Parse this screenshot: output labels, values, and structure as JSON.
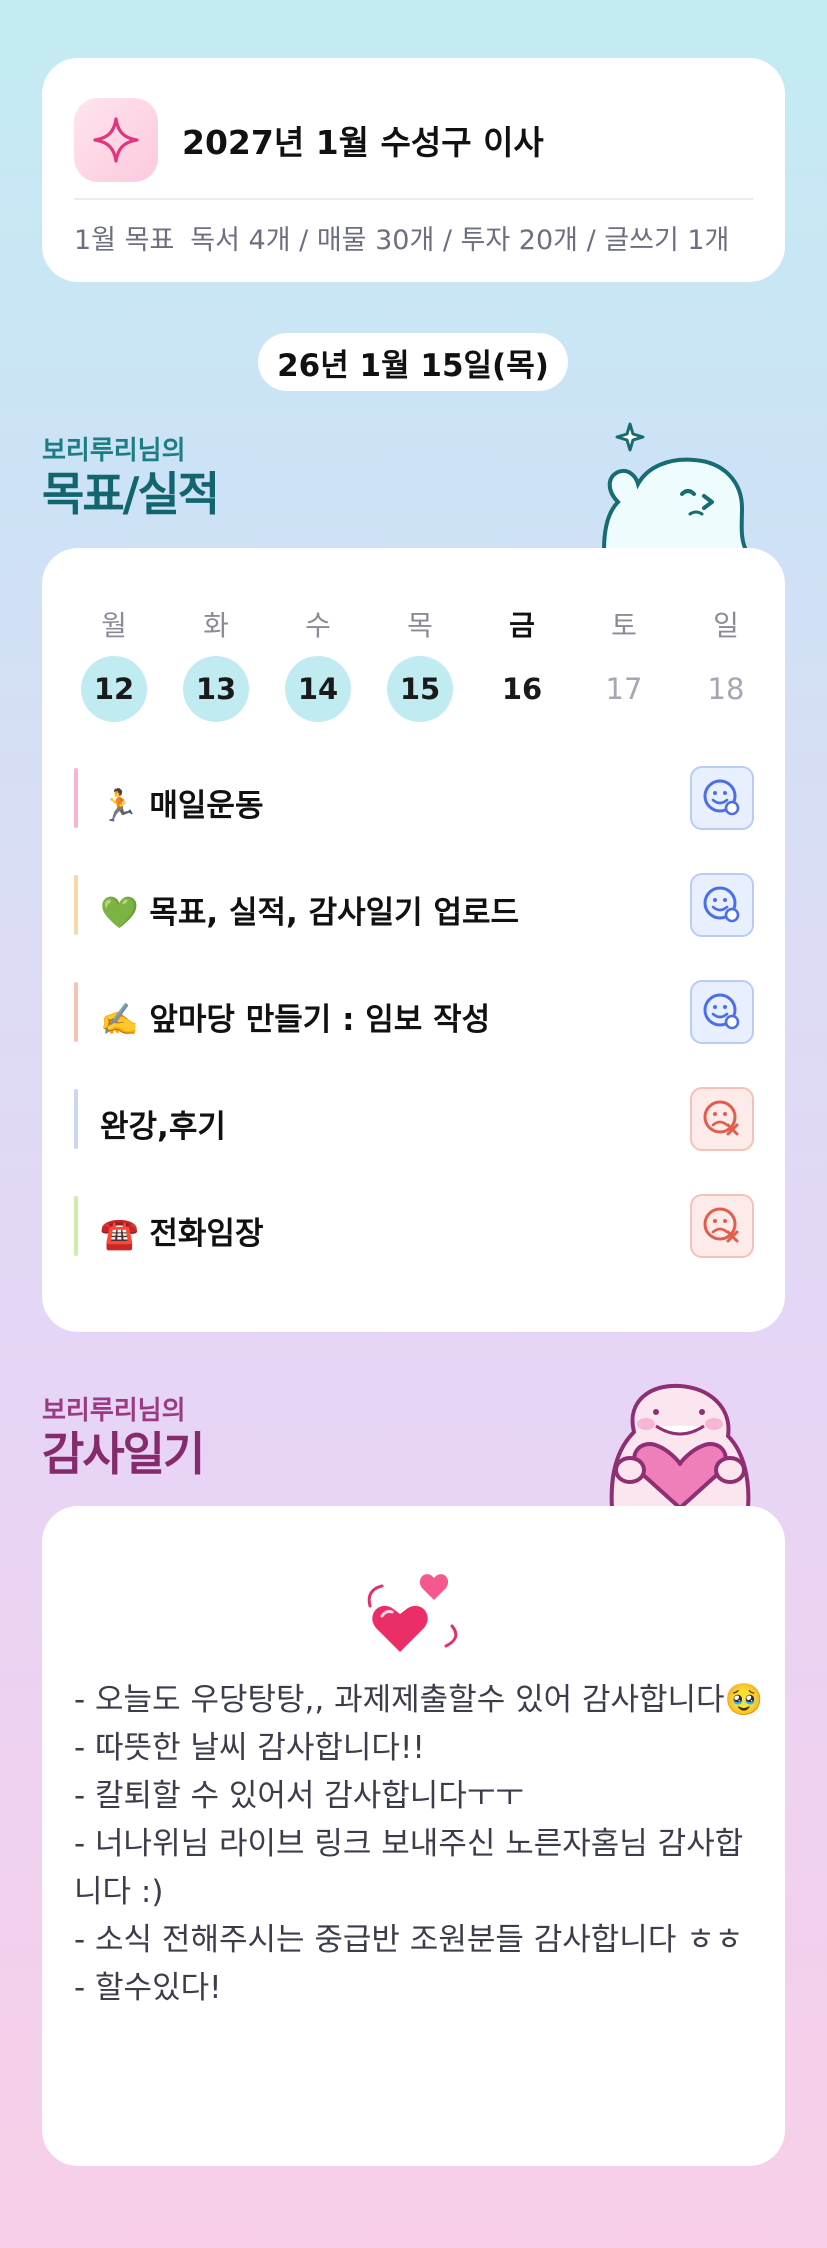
{
  "header": {
    "icon": "sparkle-icon",
    "title": "2027년 1월 수성구 이사",
    "monthly_goal_label": "1월 목표",
    "monthly_goal_text": "독서 4개 / 매물 30개 / 투자 20개 / 글쓰기 1개"
  },
  "date_label": "26년 1월 15일(목)",
  "goals_section": {
    "subtitle": "보리루리님의",
    "title": "목표/실적"
  },
  "week": {
    "days": [
      {
        "weekday": "월",
        "date": "12",
        "state": "done"
      },
      {
        "weekday": "화",
        "date": "13",
        "state": "done"
      },
      {
        "weekday": "수",
        "date": "14",
        "state": "done"
      },
      {
        "weekday": "목",
        "date": "15",
        "state": "done"
      },
      {
        "weekday": "금",
        "date": "16",
        "state": "today"
      },
      {
        "weekday": "토",
        "date": "17",
        "state": "future"
      },
      {
        "weekday": "일",
        "date": "18",
        "state": "future"
      }
    ]
  },
  "tasks": [
    {
      "label": "🏃 매일운동",
      "status": "done",
      "status_icon": "smile-check-icon",
      "bar_color": "#f6b6cf"
    },
    {
      "label": "💚 목표, 실적, 감사일기 업로드",
      "status": "done",
      "status_icon": "smile-check-icon",
      "bar_color": "#f7d9a8"
    },
    {
      "label": "✍️ 앞마당 만들기 : 임보 작성",
      "status": "done",
      "status_icon": "smile-check-icon",
      "bar_color": "#f6c3b3"
    },
    {
      "label": "완강,후기",
      "status": "fail",
      "status_icon": "frown-x-icon",
      "bar_color": "#c9d7f3"
    },
    {
      "label": "☎️ 전화임장",
      "status": "fail",
      "status_icon": "frown-x-icon",
      "bar_color": "#cdeea8"
    }
  ],
  "gratitude_section": {
    "subtitle": "보리루리님의",
    "title": "감사일기",
    "icon": "hearts-icon",
    "lines": [
      "- 오늘도 우당탕탕,, 과제제출할수 있어 감사합니다🥹",
      "- 따뜻한 날씨 감사합니다!!",
      "- 칼퇴할 수 있어서 감사합니다ㅜㅜ",
      "- 너나위님 라이브 링크 보내주신 노른자홈님 감사합니다 :)",
      "- 소식 전해주시는 중급반 조원분들 감사합니다 ㅎㅎ",
      "- 할수있다!"
    ]
  },
  "colors": {
    "done_date_bg": "#c0ecf1",
    "ok_icon": "#4a6fe8",
    "fail_icon": "#e35d4d",
    "goals_heading": "#12656f",
    "gratitude_heading": "#862a6e"
  }
}
